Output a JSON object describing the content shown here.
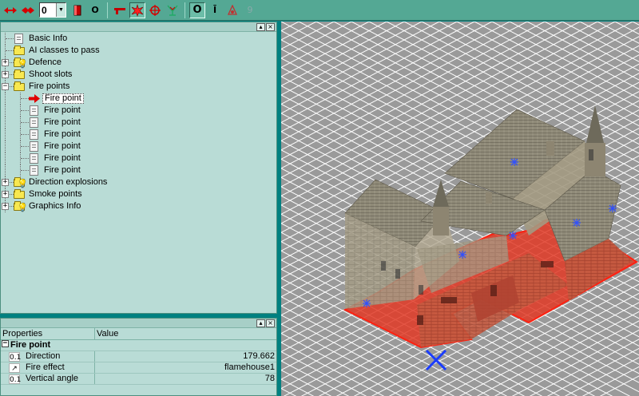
{
  "toolbar": {
    "layer_value": "0",
    "icons": [
      "move-horizontal-icon",
      "move-diamond-icon",
      "layer-combo",
      "red-block-icon",
      "o-icon",
      "gun-icon",
      "explosion-icon",
      "crosshair-icon",
      "tree-icon",
      "circle-o-icon",
      "ik-icon",
      "fire-cone-icon",
      "g-icon"
    ],
    "o_label": "O",
    "circle_label": "O",
    "ik_label": "Ī",
    "g_label": "9",
    "accent": "#d40000"
  },
  "tree": {
    "items": [
      {
        "label": "Basic Info",
        "icon": "doc-icon",
        "level": 0,
        "expander": ""
      },
      {
        "label": "AI classes to pass",
        "icon": "folder-icon",
        "level": 0,
        "expander": ""
      },
      {
        "label": "Defence",
        "icon": "folder-bulb-icon",
        "level": 0,
        "expander": "+"
      },
      {
        "label": "Shoot slots",
        "icon": "folder-icon",
        "level": 0,
        "expander": "+"
      },
      {
        "label": "Fire points",
        "icon": "folder-icon",
        "level": 0,
        "expander": "−"
      },
      {
        "label": "Fire point",
        "icon": "red-arrow-icon",
        "level": 1,
        "expander": "",
        "selected": true
      },
      {
        "label": "Fire point",
        "icon": "doc-icon",
        "level": 1,
        "expander": ""
      },
      {
        "label": "Fire point",
        "icon": "doc-icon",
        "level": 1,
        "expander": ""
      },
      {
        "label": "Fire point",
        "icon": "doc-icon",
        "level": 1,
        "expander": ""
      },
      {
        "label": "Fire point",
        "icon": "doc-icon",
        "level": 1,
        "expander": ""
      },
      {
        "label": "Fire point",
        "icon": "doc-icon",
        "level": 1,
        "expander": ""
      },
      {
        "label": "Fire point",
        "icon": "doc-icon",
        "level": 1,
        "expander": ""
      },
      {
        "label": "Direction explosions",
        "icon": "folder-bulb-icon",
        "level": 0,
        "expander": "+"
      },
      {
        "label": "Smoke points",
        "icon": "folder-icon",
        "level": 0,
        "expander": "+"
      },
      {
        "label": "Graphics Info",
        "icon": "folder-bulb-icon",
        "level": 0,
        "expander": "+"
      }
    ]
  },
  "properties": {
    "col_properties": "Properties",
    "col_value": "Value",
    "group_label": "Fire point",
    "group_expander": "−",
    "rows": [
      {
        "type": "0.1",
        "name": "Direction",
        "value": "179.662"
      },
      {
        "type": "↗",
        "name": "Fire effect",
        "value": "flamehouse1"
      },
      {
        "type": "0.1",
        "name": "Vertical angle",
        "value": "78"
      }
    ]
  },
  "panel_buttons": {
    "pin": "▴",
    "close": "×"
  },
  "viewport": {
    "grid_color": "#ffffff",
    "background": "#999999",
    "footprint_color": "#e03020",
    "marker_color": "#2040ff"
  }
}
